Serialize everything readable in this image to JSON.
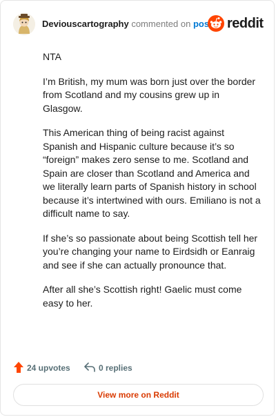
{
  "header": {
    "username": "Deviouscartography",
    "verb": "commented on",
    "post_link": "post",
    "logo_text": "reddit"
  },
  "comment": {
    "paragraphs": [
      "NTA",
      "I’m British, my mum was born just over the border from Scotland and my cousins grew up in Glasgow.",
      "This American thing of being racist against Spanish and Hispanic culture because it’s so “foreign” makes zero sense to me. Scotland and Spain are closer than Scotland and America and we literally learn parts of Spanish history in school because it’s intertwined with ours. Emiliano is not a difficult name to say.",
      "If she’s so passionate about being Scottish tell her you’re changing your name to Eirdsidh or Eanraig and see if she can actually pronounce that.",
      "After all she’s Scottish right! Gaelic must come easy to her."
    ]
  },
  "footer": {
    "upvotes": "24 upvotes",
    "replies": "0 replies",
    "view_more": "View more on Reddit"
  },
  "colors": {
    "upvote": "#ff4500",
    "link": "#0079d3",
    "view_more": "#d93a00"
  },
  "icons": [
    "avatar",
    "reddit-logo-icon",
    "upvote-arrow-icon",
    "reply-arrow-icon"
  ]
}
